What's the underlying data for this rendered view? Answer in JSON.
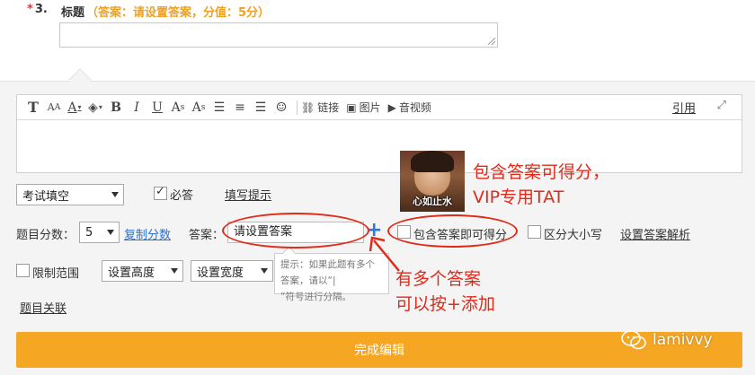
{
  "question": {
    "number_star": "*",
    "number": "3.",
    "title_label": "标题",
    "title_hint": "（答案：请设置答案，分值：5分）",
    "title_value": ""
  },
  "toolbar": {
    "link_label": "链接",
    "image_label": "图片",
    "video_label": "音视频",
    "quote_label": "引用"
  },
  "settings": {
    "type_select": "考试填空",
    "required_label": "必答",
    "required_checked": true,
    "fill_hint_link": "填写提示",
    "score_label": "题目分数：",
    "score_value": "5",
    "copy_score_link": "复制分数",
    "answer_label": "答案：",
    "answer_value": "请设置答案",
    "contains_answer_label": "包含答案即可得分",
    "case_sensitive_label": "区分大小写",
    "answer_analysis_link": "设置答案解析",
    "limit_range_label": "限制范围",
    "height_select": "设置高度",
    "width_select": "设置宽度",
    "related_link": "题目关联",
    "tooltip_line1": "提示：如果此题有多个答案，请以“|",
    "tooltip_line2": "”符号进行分隔。",
    "finish_button": "完成编辑"
  },
  "annotations": {
    "note1_line1": "包含答案可得分，",
    "note1_line2": "VIP专用TAT",
    "note2_line1": "有多个答案",
    "note2_line2": "可以按+添加",
    "meme_caption": "心如止水",
    "annotation_color": "#e02a1a"
  },
  "watermark": {
    "text": "lamivvy"
  },
  "colors": {
    "accent": "#f5a623",
    "link_blue": "#2a6fd6",
    "hint_orange": "#f0a020"
  }
}
